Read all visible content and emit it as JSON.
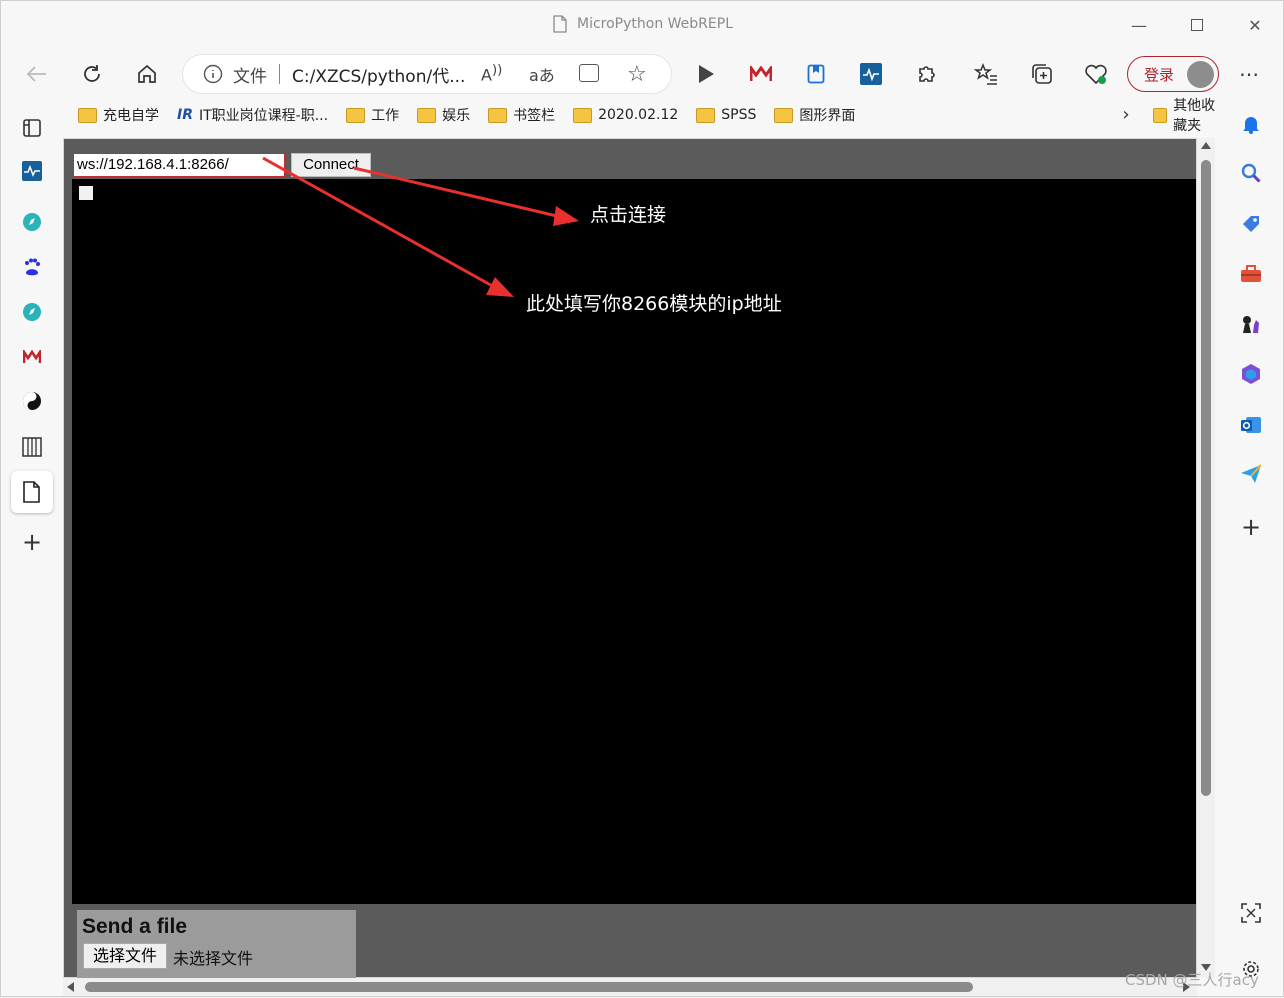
{
  "window": {
    "title": "MicroPython WebREPL"
  },
  "toolbar": {
    "back_icon": "back-arrow-icon",
    "refresh_icon": "refresh-icon",
    "home_icon": "home-icon",
    "address_label": "文件",
    "address_text": "C:/XZCS/python/代...",
    "login_label": "登录"
  },
  "bookmarks": [
    {
      "label": "充电自学",
      "icon": "folder-icon"
    },
    {
      "label": "IT职业岗位课程-职...",
      "icon": "site-icon"
    },
    {
      "label": "工作",
      "icon": "folder-icon"
    },
    {
      "label": "娱乐",
      "icon": "folder-icon"
    },
    {
      "label": "书签栏",
      "icon": "folder-icon"
    },
    {
      "label": "2020.02.12",
      "icon": "folder-icon"
    },
    {
      "label": "SPSS",
      "icon": "folder-icon"
    },
    {
      "label": "图形界面",
      "icon": "folder-icon"
    }
  ],
  "bookmarks_other": "其他收藏夹",
  "webrepl": {
    "url_value": "ws://192.168.4.1:8266/",
    "connect_label": "Connect",
    "file_title": "Send a file",
    "choose_label": "选择文件",
    "choose_status": "未选择文件"
  },
  "annotations": {
    "connect_note": "点击连接",
    "ip_note": "此处填写你8266模块的ip地址",
    "arrow_color": "#e8302e"
  },
  "watermark": "CSDN @三人行acy"
}
